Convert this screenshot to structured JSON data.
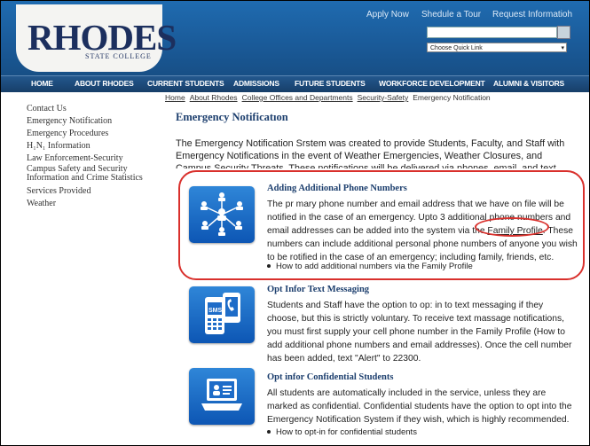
{
  "header": {
    "logo_text": "RHODES",
    "logo_sub": "STATE COLLEGE",
    "top_links": [
      "Apply Now",
      "Shedule a Tour",
      "Request Informatioh"
    ],
    "quick_link": "Choose Quick Link"
  },
  "nav": [
    "HOME",
    "ABOUT RHODES",
    "CURRENT STUDENTS",
    "ADMISSIONS",
    "FUTURE STUDENTS",
    "WORKFORCE DEVELOPMENT",
    "ALUMNI & VISITORS"
  ],
  "sidebar": [
    "Contact Us",
    "Emergency Notification",
    "Emergency Procedures",
    "H₁N₁ Information",
    "Law Enforcement-Security",
    "Campus Safety and Security Information and Crime Statistics",
    "Services Provided",
    "Weather"
  ],
  "breadcrumb": {
    "links": [
      "Home",
      "About Rhodes",
      "College Offices and Departments",
      "Security-Safety"
    ],
    "current": "Emergency Notification"
  },
  "page_title": "Emergency Notificatıon",
  "intro": "The Emergency Notification Srstem was created to provide Students, Faculty, and Staff with Emergency Notifications in the event of Weather Emergencies, Weather Closures, and Campus Security Threats. These notifications will be delivered via phones, email, and text message.",
  "blocks": [
    {
      "title": "Adding Additional Phone Numbers",
      "text_before": "The pr mary phone number and email address that we have on file will be notified in the case of an emergency. Upto 3 additional phone numbers and email addresses can be added into the system via the ",
      "link": "Family Profile",
      "text_after": ". These numbers can include additional personal phone numbers of anyone you wish to be rotified in the case of an emergency; including family, friends, etc.",
      "bullet": "How to add additional numbers via the Family Profile"
    },
    {
      "title": "Opt Infor Text Messaging",
      "text": "Students and Staff have the option to op: in to text messaging if they choose, but this is strictly voluntary. To receive text massage notifications, you must first supply your cell phone number in the Family Profile (How to add additional phone numbers and email addresses). Once the cell number has been added, text \"Alert\" to 22300."
    },
    {
      "title": "Opt infor Confidential Students",
      "text": "All students are automatically included in the service, unless they are marked as confidential. Confidential students have the option to opt into the Emergency Notification System if they wish, which is highly recommended.",
      "bullet": "How to opt-in for confidential students"
    }
  ],
  "icons": [
    "network-people-icon",
    "sms-phone-icon",
    "laptop-profile-icon"
  ],
  "colors": {
    "header_blue": "#1f6bb0",
    "nav_blue": "#173e68",
    "title_blue": "#1d3f6e",
    "highlight_red": "#d9302c"
  }
}
